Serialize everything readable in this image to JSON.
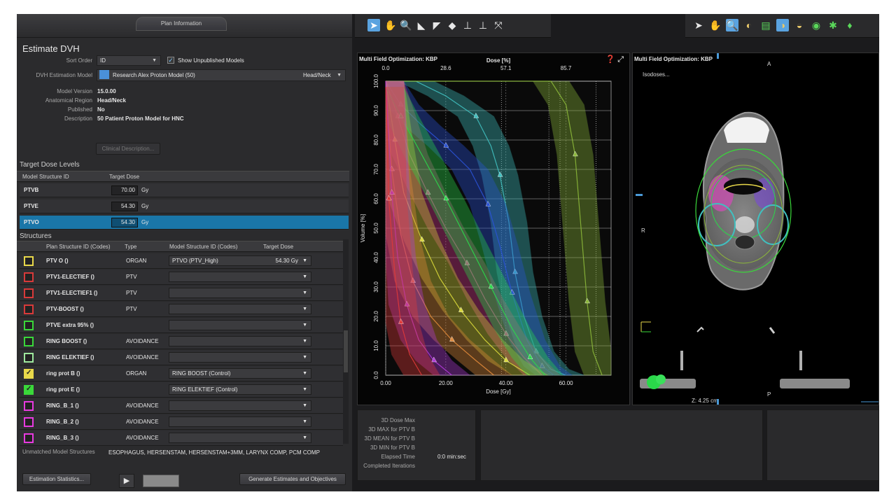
{
  "tab": {
    "label": "Plan Information"
  },
  "estimate": {
    "title": "Estimate DVH",
    "sort_order_label": "Sort Order",
    "sort_order_value": "ID",
    "show_unpublished_label": "Show Unpublished Models",
    "dvh_model_label": "DVH Estimation Model",
    "dvh_model_value": "Research Alex Proton Model (50)",
    "dvh_model_site": "Head/Neck",
    "model_version_label": "Model Version",
    "model_version_value": "15.0.00",
    "anatomical_region_label": "Anatomical Region",
    "anatomical_region_value": "Head/Neck",
    "published_label": "Published",
    "published_value": "No",
    "description_label": "Description",
    "description_value": "50 Patient Proton Model for HNC",
    "clinical_desc_button": "Clinical Description..."
  },
  "target_dose": {
    "section_title": "Target Dose Levels",
    "col_model_structure": "Model Structure ID",
    "col_target_dose": "Target Dose",
    "rows": [
      {
        "id": "PTVB",
        "dose": "70.00",
        "unit": "Gy"
      },
      {
        "id": "PTVE",
        "dose": "54.30",
        "unit": "Gy"
      },
      {
        "id": "PTVO",
        "dose": "54.30",
        "unit": "Gy"
      }
    ]
  },
  "structures": {
    "section_title": "Structures",
    "col_plan_structure": "Plan Structure ID (Codes)",
    "col_type": "Type",
    "col_model_structure": "Model Structure ID (Codes)",
    "col_target_dose": "Target Dose",
    "rows": [
      {
        "color": "#e8d84a",
        "checked": false,
        "id": "PTV O ()",
        "type": "ORGAN",
        "model": "PTVO (PTV_High)",
        "dose": "54.30 Gy"
      },
      {
        "color": "#d83a3a",
        "checked": false,
        "id": "PTV1-ELECTIEF ()",
        "type": "PTV",
        "model": "",
        "dose": ""
      },
      {
        "color": "#d83a3a",
        "checked": false,
        "id": "PTV1-ELECTIEF1 ()",
        "type": "PTV",
        "model": "",
        "dose": ""
      },
      {
        "color": "#d83a3a",
        "checked": false,
        "id": "PTV-BOOST ()",
        "type": "PTV",
        "model": "",
        "dose": ""
      },
      {
        "color": "#3ad83a",
        "checked": false,
        "id": "PTVE extra 95% ()",
        "type": "",
        "model": "",
        "dose": ""
      },
      {
        "color": "#3ad83a",
        "checked": false,
        "id": "RING BOOST ()",
        "type": "AVOIDANCE",
        "model": "",
        "dose": ""
      },
      {
        "color": "#9ee89e",
        "checked": false,
        "id": "RING ELEKTIEF ()",
        "type": "AVOIDANCE",
        "model": "",
        "dose": ""
      },
      {
        "color": "#e8d84a",
        "checked": true,
        "id": "ring prot B ()",
        "type": "ORGAN",
        "model": "RING BOOST (Control)",
        "dose": ""
      },
      {
        "color": "#3ad83a",
        "checked": true,
        "id": "ring prot E ()",
        "type": "",
        "model": "RING ELEKTIEF (Control)",
        "dose": ""
      },
      {
        "color": "#e83ae0",
        "checked": false,
        "id": "RING_B_1 ()",
        "type": "AVOIDANCE",
        "model": "",
        "dose": ""
      },
      {
        "color": "#e83ae0",
        "checked": false,
        "id": "RING_B_2 ()",
        "type": "AVOIDANCE",
        "model": "",
        "dose": ""
      },
      {
        "color": "#e83ae0",
        "checked": false,
        "id": "RING_B_3 ()",
        "type": "AVOIDANCE",
        "model": "",
        "dose": ""
      }
    ]
  },
  "unmatched": {
    "label": "Unmatched Model Structures",
    "value": "ESOPHAGUS, HERSENSTAM, HERSENSTAM+3MM, LARYNX COMP, PCM COMP"
  },
  "buttons": {
    "estimation_statistics": "Estimation Statistics...",
    "generate": "Generate Estimates and Objectives"
  },
  "dvh": {
    "title": "Multi Field Optimization: KBP"
  },
  "ct": {
    "title": "Multi Field Optimization: KBP",
    "isodoses": "Isodoses...",
    "label_a": "A",
    "label_r": "R",
    "label_p": "P",
    "z_value": "Z: 4.25 cm"
  },
  "stats": {
    "dose_max_label": "3D Dose Max",
    "max_ptv_label": "3D MAX for PTV B",
    "mean_ptv_label": "3D MEAN for PTV B",
    "min_ptv_label": "3D MIN for PTV B",
    "elapsed_label": "Elapsed Time",
    "elapsed_value": "0:0  min:sec",
    "iterations_label": "Completed Iterations"
  },
  "chart_data": {
    "type": "line",
    "title": "Multi Field Optimization: KBP",
    "xlabel": "Dose [Gy]",
    "ylabel": "Volume [%]",
    "top_axis_label": "Dose [%]",
    "xlim": [
      0,
      75
    ],
    "ylim": [
      0,
      100
    ],
    "x_ticks": [
      "0.00",
      "20.00",
      "40.00",
      "60.00"
    ],
    "x_tick_values": [
      0,
      20,
      40,
      60
    ],
    "top_ticks": [
      "0.0",
      "28.6",
      "57.1",
      "85.7"
    ],
    "top_tick_values": [
      0,
      20,
      40,
      60
    ],
    "y_ticks": [
      "0.0",
      "10.0",
      "20.0",
      "30.0",
      "40.0",
      "50.0",
      "60.0",
      "70.0",
      "80.0",
      "90.0",
      "100.0"
    ],
    "y_tick_values": [
      0,
      10,
      20,
      30,
      40,
      50,
      60,
      70,
      80,
      90,
      100
    ],
    "grid": true,
    "series": [
      {
        "color": "#40c0c0",
        "values": [
          [
            0,
            100
          ],
          [
            10,
            100
          ],
          [
            20,
            95
          ],
          [
            30,
            88
          ],
          [
            35,
            78
          ],
          [
            38,
            68
          ],
          [
            41,
            52
          ],
          [
            43,
            35
          ],
          [
            46,
            20
          ],
          [
            50,
            8
          ],
          [
            55,
            2
          ],
          [
            60,
            0
          ]
        ]
      },
      {
        "color": "#8cb83a",
        "values": [
          [
            0,
            100
          ],
          [
            55,
            100
          ],
          [
            60,
            92
          ],
          [
            63,
            75
          ],
          [
            65,
            50
          ],
          [
            67,
            25
          ],
          [
            69,
            8
          ],
          [
            72,
            0
          ]
        ]
      },
      {
        "color": "#2a52d6",
        "values": [
          [
            0,
            100
          ],
          [
            5,
            92
          ],
          [
            12,
            85
          ],
          [
            20,
            78
          ],
          [
            28,
            70
          ],
          [
            34,
            58
          ],
          [
            38,
            44
          ],
          [
            42,
            28
          ],
          [
            47,
            12
          ],
          [
            52,
            3
          ],
          [
            56,
            0
          ]
        ]
      },
      {
        "color": "#d43a8a",
        "values": [
          [
            0,
            100
          ],
          [
            4,
            88
          ],
          [
            8,
            75
          ],
          [
            14,
            62
          ],
          [
            20,
            50
          ],
          [
            27,
            38
          ],
          [
            33,
            26
          ],
          [
            40,
            14
          ],
          [
            46,
            6
          ],
          [
            52,
            0
          ]
        ]
      },
      {
        "color": "#d8d83a",
        "values": [
          [
            0,
            100
          ],
          [
            3,
            80
          ],
          [
            6,
            62
          ],
          [
            12,
            46
          ],
          [
            18,
            33
          ],
          [
            25,
            22
          ],
          [
            33,
            12
          ],
          [
            40,
            5
          ],
          [
            48,
            0
          ]
        ]
      },
      {
        "color": "#2ad84a",
        "values": [
          [
            0,
            98
          ],
          [
            5,
            88
          ],
          [
            12,
            75
          ],
          [
            20,
            60
          ],
          [
            28,
            44
          ],
          [
            35,
            30
          ],
          [
            42,
            16
          ],
          [
            48,
            6
          ],
          [
            53,
            0
          ]
        ]
      },
      {
        "color": "#e08a3a",
        "values": [
          [
            0,
            100
          ],
          [
            2,
            70
          ],
          [
            5,
            48
          ],
          [
            9,
            32
          ],
          [
            15,
            20
          ],
          [
            22,
            12
          ],
          [
            30,
            5
          ],
          [
            36,
            0
          ]
        ]
      },
      {
        "color": "#b03ad8",
        "values": [
          [
            0,
            100
          ],
          [
            2,
            62
          ],
          [
            4,
            40
          ],
          [
            7,
            24
          ],
          [
            11,
            12
          ],
          [
            16,
            5
          ],
          [
            22,
            0
          ]
        ]
      },
      {
        "color": "#e03a3a",
        "values": [
          [
            0,
            98
          ],
          [
            1,
            60
          ],
          [
            3,
            35
          ],
          [
            5,
            18
          ],
          [
            8,
            7
          ],
          [
            12,
            0
          ]
        ]
      }
    ]
  }
}
